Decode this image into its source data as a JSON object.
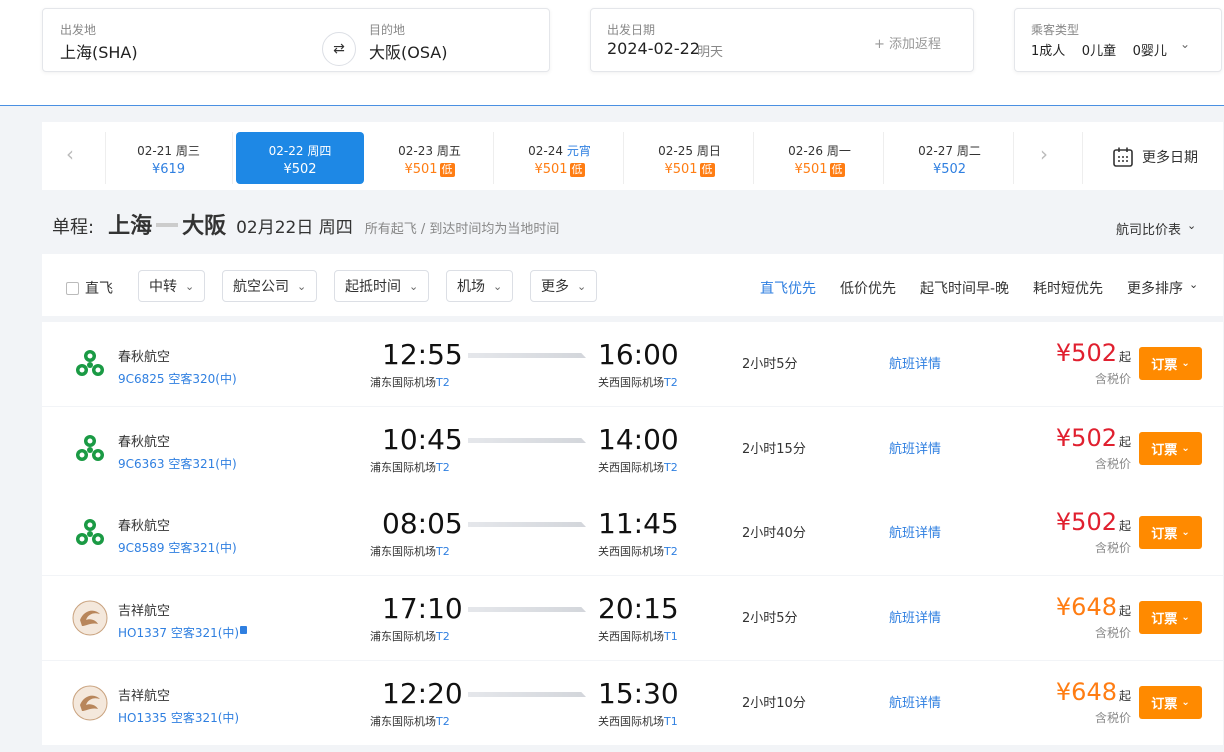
{
  "search": {
    "from_label": "出发地",
    "from_value": "上海(SHA)",
    "to_label": "目的地",
    "to_value": "大阪(OSA)",
    "date_label": "出发日期",
    "date_value": "2024-02-22",
    "date_hint": "明天",
    "add_return": "+ 添加返程",
    "passenger_label": "乘客类型",
    "passengers": "1成人    0儿童    0婴儿"
  },
  "dates": [
    {
      "date": "02-21",
      "day": "周三",
      "price": "¥619",
      "low": ""
    },
    {
      "date": "02-22",
      "day": "周四",
      "price": "¥502",
      "low": ""
    },
    {
      "date": "02-23",
      "day": "周五",
      "price": "¥501",
      "low": "低"
    },
    {
      "date": "02-24",
      "day": "元宵",
      "price": "¥501",
      "low": "低"
    },
    {
      "date": "02-25",
      "day": "周日",
      "price": "¥501",
      "low": "低"
    },
    {
      "date": "02-26",
      "day": "周一",
      "price": "¥501",
      "low": "低"
    },
    {
      "date": "02-27",
      "day": "周二",
      "price": "¥502",
      "low": ""
    }
  ],
  "more_dates": "更多日期",
  "trip": {
    "prefix": "单程:",
    "from": "上海",
    "to": "大阪",
    "date": "02月22日 周四",
    "note": "所有起飞 / 到达时间均为当地时间",
    "compare": "航司比价表"
  },
  "filters": {
    "direct": "直飞",
    "transfer": "中转",
    "airline": "航空公司",
    "time": "起抵时间",
    "airport": "机场",
    "more": "更多"
  },
  "sorts": {
    "direct_first": "直飞优先",
    "low_price": "低价优先",
    "early": "起飞时间早-晚",
    "short": "耗时短优先",
    "more": "更多排序"
  },
  "flights": [
    {
      "airline": "春秋航空",
      "fno": "9C6825 空客320(中)",
      "dep": "12:55",
      "dep_ap": "浦东国际机场",
      "dep_t": "T2",
      "arr": "16:00",
      "arr_ap": "关西国际机场",
      "arr_t": "T2",
      "dur": "2小时5分",
      "detail": "航班详情",
      "price": "¥502",
      "qi": "起",
      "tax": "含税价",
      "book": "订票",
      "price_color": "#e0202f"
    },
    {
      "airline": "春秋航空",
      "fno": "9C6363 空客321(中)",
      "dep": "10:45",
      "dep_ap": "浦东国际机场",
      "dep_t": "T2",
      "arr": "14:00",
      "arr_ap": "关西国际机场",
      "arr_t": "T2",
      "dur": "2小时15分",
      "detail": "航班详情",
      "price": "¥502",
      "qi": "起",
      "tax": "含税价",
      "book": "订票",
      "price_color": "#e0202f"
    },
    {
      "airline": "春秋航空",
      "fno": "9C8589 空客321(中)",
      "dep": "08:05",
      "dep_ap": "浦东国际机场",
      "dep_t": "T2",
      "arr": "11:45",
      "arr_ap": "关西国际机场",
      "arr_t": "T2",
      "dur": "2小时40分",
      "detail": "航班详情",
      "price": "¥502",
      "qi": "起",
      "tax": "含税价",
      "book": "订票",
      "price_color": "#e0202f"
    },
    {
      "airline": "吉祥航空",
      "fno": "HO1337 空客321(中)",
      "dep": "17:10",
      "dep_ap": "浦东国际机场",
      "dep_t": "T2",
      "arr": "20:15",
      "arr_ap": "关西国际机场",
      "arr_t": "T1",
      "dur": "2小时5分",
      "detail": "航班详情",
      "price": "¥648",
      "qi": "起",
      "tax": "含税价",
      "book": "订票",
      "price_color": "#ff7d13"
    },
    {
      "airline": "吉祥航空",
      "fno": "HO1335 空客321(中)",
      "dep": "12:20",
      "dep_ap": "浦东国际机场",
      "dep_t": "T2",
      "arr": "15:30",
      "arr_ap": "关西国际机场",
      "arr_t": "T1",
      "dur": "2小时10分",
      "detail": "航班详情",
      "price": "¥648",
      "qi": "起",
      "tax": "含税价",
      "book": "订票",
      "price_color": "#ff7d13"
    }
  ]
}
